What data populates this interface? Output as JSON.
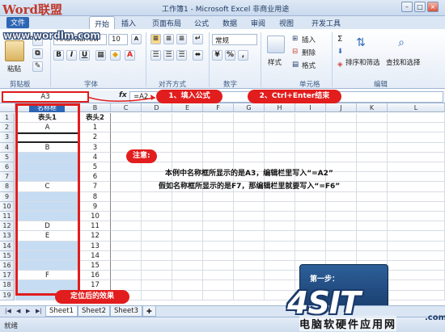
{
  "brand": {
    "logo": "Word联盟",
    "url": "www.wordlm.com"
  },
  "window": {
    "title": "工作簿1 - Microsoft Excel 非商业用途",
    "controls": [
      "–",
      "□",
      "×"
    ]
  },
  "tabs": [
    {
      "label": "文件"
    },
    {
      "label": "开始"
    },
    {
      "label": "插入"
    },
    {
      "label": "页面布局"
    },
    {
      "label": "公式"
    },
    {
      "label": "数据"
    },
    {
      "label": "审阅"
    },
    {
      "label": "视图"
    },
    {
      "label": "开发工具"
    }
  ],
  "ribbon": {
    "paste": "粘贴",
    "font_name": "Arial Narrow",
    "font_size": "10",
    "bold": "B",
    "italic": "I",
    "underline": "U",
    "number_format": "常规",
    "style": "样式",
    "insert": "插入",
    "delete": "删除",
    "format": "格式",
    "sort_filter": "排序和筛选",
    "find_select": "查找和选择",
    "groups": {
      "clipboard": "剪贴板",
      "font": "字体",
      "alignment": "对齐方式",
      "number": "数字",
      "cells": "单元格",
      "editing": "编辑"
    }
  },
  "formula_bar": {
    "name_box": "A3",
    "fx": "fx",
    "formula": "=A2"
  },
  "callouts": {
    "step1": "1、填入公式",
    "step2": "2、Ctrl+Enter结束",
    "result": "定位后的效果"
  },
  "columns": [
    "A",
    "B",
    "C",
    "D",
    "E",
    "F",
    "G",
    "H",
    "I",
    "J",
    "K",
    "L"
  ],
  "name_tag": "名称框",
  "rows": [
    {
      "n": "1",
      "a": "表头1",
      "b": "表头2",
      "blue": false
    },
    {
      "n": "2",
      "a": "A",
      "b": "1",
      "blue": false
    },
    {
      "n": "3",
      "a": "",
      "b": "2",
      "blue": false
    },
    {
      "n": "4",
      "a": "B",
      "b": "3",
      "blue": false
    },
    {
      "n": "5",
      "a": "",
      "b": "4",
      "blue": true
    },
    {
      "n": "6",
      "a": "",
      "b": "5",
      "blue": true
    },
    {
      "n": "7",
      "a": "",
      "b": "6",
      "blue": true
    },
    {
      "n": "8",
      "a": "C",
      "b": "7",
      "blue": false
    },
    {
      "n": "9",
      "a": "",
      "b": "8",
      "blue": true
    },
    {
      "n": "10",
      "a": "",
      "b": "9",
      "blue": true
    },
    {
      "n": "11",
      "a": "",
      "b": "10",
      "blue": true
    },
    {
      "n": "12",
      "a": "D",
      "b": "11",
      "blue": false
    },
    {
      "n": "13",
      "a": "E",
      "b": "12",
      "blue": false
    },
    {
      "n": "14",
      "a": "",
      "b": "13",
      "blue": true
    },
    {
      "n": "15",
      "a": "",
      "b": "14",
      "blue": true
    },
    {
      "n": "16",
      "a": "",
      "b": "15",
      "blue": true
    },
    {
      "n": "17",
      "a": "F",
      "b": "16",
      "blue": false
    },
    {
      "n": "18",
      "a": "",
      "b": "17",
      "blue": true
    },
    {
      "n": "19",
      "a": "",
      "b": "18",
      "blue": true
    }
  ],
  "note": {
    "title": "注意:",
    "line1": "本例中名称框所显示的是A3，编辑栏里写入“=A2”",
    "line2": "假如名称框所显示的是F7，那编辑栏里就要写入“=F6”"
  },
  "step_panel": "第一步：",
  "sheets": [
    "Sheet1",
    "Sheet2",
    "Sheet3"
  ],
  "status": "就绪",
  "watermark": {
    "logo": "4SIT",
    "domain": ".com",
    "cn": "电脑软硬件应用网"
  },
  "colors": {
    "highlight_red": "#e21d1d",
    "selection_blue": "#c5dcf3",
    "ribbon_border": "#9fb6d3"
  }
}
